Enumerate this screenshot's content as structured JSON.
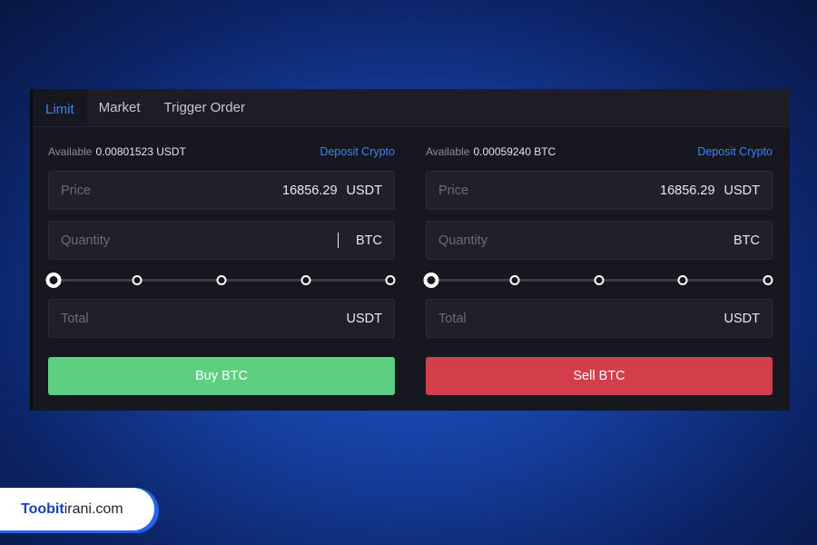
{
  "tabs": [
    {
      "label": "Limit",
      "active": true
    },
    {
      "label": "Market",
      "active": false
    },
    {
      "label": "Trigger Order",
      "active": false
    }
  ],
  "buy_form": {
    "available_label": "Available",
    "available_value": "0.00801523 USDT",
    "deposit_link": "Deposit Crypto",
    "price_placeholder": "Price",
    "price_value": "16856.29",
    "price_unit": "USDT",
    "quantity_placeholder": "Quantity",
    "quantity_unit": "BTC",
    "slider_level_percent": 0,
    "total_placeholder": "Total",
    "total_unit": "USDT",
    "action_label": "Buy BTC"
  },
  "sell_form": {
    "available_label": "Available",
    "available_value": "0.00059240 BTC",
    "deposit_link": "Deposit Crypto",
    "price_placeholder": "Price",
    "price_value": "16856.29",
    "price_unit": "USDT",
    "quantity_placeholder": "Quantity",
    "quantity_unit": "BTC",
    "slider_level_percent": 0,
    "total_placeholder": "Total",
    "total_unit": "USDT",
    "action_label": "Sell BTC"
  },
  "brand": {
    "bold": "Toobit",
    "rest": "irani.com"
  },
  "colors": {
    "accent_blue": "#3b82f6",
    "buy_green": "#5ecf80",
    "sell_red": "#d23f4b",
    "panel_bg": "#17181f"
  }
}
